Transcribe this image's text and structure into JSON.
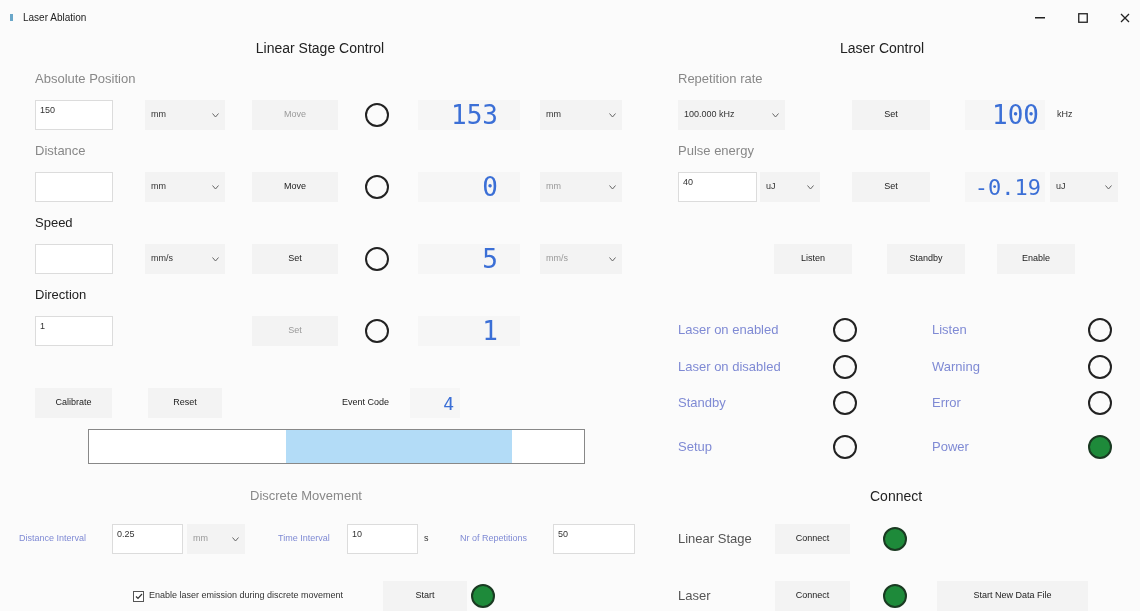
{
  "window": {
    "title": "Laser Ablation"
  },
  "linear_stage": {
    "title": "Linear Stage Control",
    "rows": [
      {
        "label": "Absolute Position",
        "label_disabled": true,
        "value": "150",
        "unit": "mm",
        "button": "Move",
        "button_disabled": true,
        "indicator_on": false,
        "reading": "153",
        "reading_unit": "mm"
      },
      {
        "label": "Distance",
        "label_disabled": true,
        "value": "",
        "unit": "mm",
        "button": "Move",
        "button_disabled": false,
        "indicator_on": false,
        "reading": "0",
        "reading_unit": "mm"
      },
      {
        "label": "Speed",
        "label_disabled": false,
        "value": "",
        "unit": "mm/s",
        "button": "Set",
        "button_disabled": false,
        "indicator_on": false,
        "reading": "5",
        "reading_unit": "mm/s"
      },
      {
        "label": "Direction",
        "label_disabled": false,
        "value": "1",
        "button": "Set",
        "button_disabled": true,
        "indicator_on": false,
        "reading": "1"
      }
    ],
    "calibrate": "Calibrate",
    "reset": "Reset",
    "event_code_label": "Event Code",
    "event_code": "4"
  },
  "discrete_movement": {
    "title": "Discrete Movement",
    "distance_label": "Distance Interval",
    "distance": "0.25",
    "distance_unit": "mm",
    "time_label": "Time Interval",
    "time": "10",
    "time_unit": "s",
    "repetitions_label": "Nr of Repetitions",
    "repetitions": "50",
    "enable_emission": {
      "label": "Enable laser emission during discrete movement",
      "checked": true
    },
    "start": "Start",
    "running_on": true
  },
  "laser_control": {
    "title": "Laser Control",
    "repetition": {
      "label": "Repetition rate",
      "select": "100.000 kHz",
      "button": "Set",
      "reading": "100",
      "reading_unit": "kHz"
    },
    "pulse": {
      "label": "Pulse energy",
      "value": "40",
      "unit": "uJ",
      "button": "Set",
      "reading": "-0.19",
      "reading_unit": "uJ"
    },
    "buttons": [
      "Listen",
      "Standby",
      "Enable"
    ],
    "status": [
      {
        "label": "Laser on enabled",
        "on": false
      },
      {
        "label": "Listen",
        "on": false
      },
      {
        "label": "Laser on disabled",
        "on": false
      },
      {
        "label": "Warning",
        "on": false
      },
      {
        "label": "Standby",
        "on": false
      },
      {
        "label": "Error",
        "on": false
      },
      {
        "label": "Setup",
        "on": false
      },
      {
        "label": "Power",
        "on": true
      }
    ]
  },
  "connect": {
    "title": "Connect",
    "devices": [
      {
        "label": "Linear Stage",
        "button": "Connect",
        "on": true
      },
      {
        "label": "Laser",
        "button": "Connect",
        "on": true
      }
    ],
    "new_file": "Start New Data File"
  }
}
